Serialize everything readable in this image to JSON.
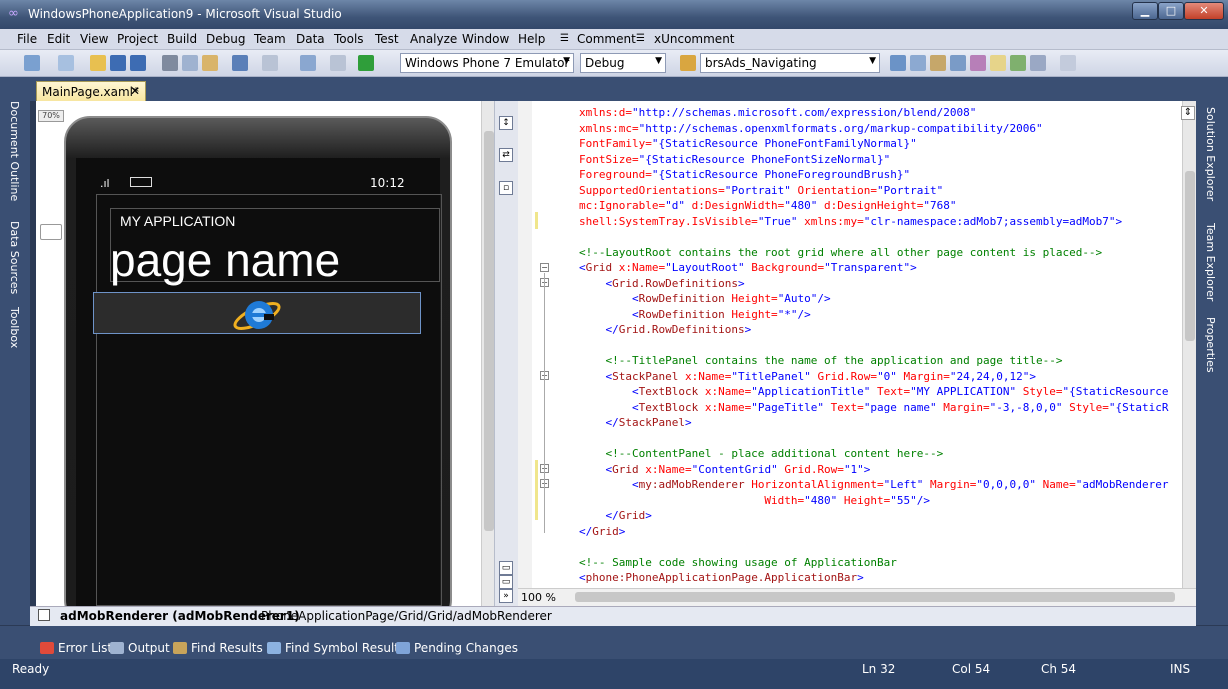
{
  "window": {
    "title": "WindowsPhoneApplication9 - Microsoft Visual Studio",
    "min": "▁",
    "max": "□",
    "close": "✕"
  },
  "menu": [
    "File",
    "Edit",
    "View",
    "Project",
    "Build",
    "Debug",
    "Team",
    "Data",
    "Tools",
    "Test",
    "Analyze",
    "Window",
    "Help",
    "Comment",
    "xUncomment"
  ],
  "toolbar": {
    "target": "Windows Phone 7 Emulator",
    "config": "Debug",
    "find": "brsAds_Navigating"
  },
  "left_rail": [
    "Document Outline",
    "Data Sources",
    "Toolbox"
  ],
  "right_rail": [
    "Solution Explorer",
    "Team Explorer",
    "Properties"
  ],
  "doc_tab": {
    "label": "MainPage.xaml*",
    "close": "✕"
  },
  "designer": {
    "zoom": "70%",
    "signal": ".ıl",
    "time": "10:12",
    "app_title": "MY APPLICATION",
    "page_title": "page name"
  },
  "code_lines": [
    [
      [
        "attr",
        "xmlns:d="
      ],
      [
        "val",
        "\"http://schemas.microsoft.com/expression/blend/2008\""
      ]
    ],
    [
      [
        "attr",
        "xmlns:mc="
      ],
      [
        "val",
        "\"http://schemas.openxmlformats.org/markup-compatibility/2006\""
      ]
    ],
    [
      [
        "attr",
        "FontFamily="
      ],
      [
        "val",
        "\"{StaticResource PhoneFontFamilyNormal}\""
      ]
    ],
    [
      [
        "attr",
        "FontSize="
      ],
      [
        "val",
        "\"{StaticResource PhoneFontSizeNormal}\""
      ]
    ],
    [
      [
        "attr",
        "Foreground="
      ],
      [
        "val",
        "\"{StaticResource PhoneForegroundBrush}\""
      ]
    ],
    [
      [
        "attr",
        "SupportedOrientations="
      ],
      [
        "val",
        "\"Portrait\""
      ],
      [
        "attr",
        " Orientation="
      ],
      [
        "val",
        "\"Portrait\""
      ]
    ],
    [
      [
        "attr",
        "mc:Ignorable="
      ],
      [
        "val",
        "\"d\""
      ],
      [
        "attr",
        " d:DesignWidth="
      ],
      [
        "val",
        "\"480\""
      ],
      [
        "attr",
        " d:DesignHeight="
      ],
      [
        "val",
        "\"768\""
      ]
    ],
    [
      [
        "attr",
        "shell:SystemTray.IsVisible="
      ],
      [
        "val",
        "\"True\""
      ],
      [
        "attr",
        " xmlns:my="
      ],
      [
        "val",
        "\"clr-namespace:adMob7;assembly=adMob7\""
      ],
      [
        "val",
        ">"
      ]
    ],
    [],
    [
      [
        "comment",
        "<!--LayoutRoot contains the root grid where all other page content is placed-->"
      ]
    ],
    [
      [
        "val",
        "<"
      ],
      [
        "tag",
        "Grid"
      ],
      [
        "attr",
        " x:Name="
      ],
      [
        "val",
        "\"LayoutRoot\""
      ],
      [
        "attr",
        " Background="
      ],
      [
        "val",
        "\"Transparent\">"
      ]
    ],
    [
      [
        "val",
        "    <"
      ],
      [
        "tag",
        "Grid.RowDefinitions"
      ],
      [
        "val",
        ">"
      ]
    ],
    [
      [
        "val",
        "        <"
      ],
      [
        "tag",
        "RowDefinition"
      ],
      [
        "attr",
        " Height="
      ],
      [
        "val",
        "\"Auto\"/>"
      ]
    ],
    [
      [
        "val",
        "        <"
      ],
      [
        "tag",
        "RowDefinition"
      ],
      [
        "attr",
        " Height="
      ],
      [
        "val",
        "\"*\"/>"
      ]
    ],
    [
      [
        "val",
        "    </"
      ],
      [
        "tag",
        "Grid.RowDefinitions"
      ],
      [
        "val",
        ">"
      ]
    ],
    [],
    [
      [
        "comment",
        "    <!--TitlePanel contains the name of the application and page title-->"
      ]
    ],
    [
      [
        "val",
        "    <"
      ],
      [
        "tag",
        "StackPanel"
      ],
      [
        "attr",
        " x:Name="
      ],
      [
        "val",
        "\"TitlePanel\""
      ],
      [
        "attr",
        " Grid.Row="
      ],
      [
        "val",
        "\"0\""
      ],
      [
        "attr",
        " Margin="
      ],
      [
        "val",
        "\"24,24,0,12\">"
      ]
    ],
    [
      [
        "val",
        "        <"
      ],
      [
        "tag",
        "TextBlock"
      ],
      [
        "attr",
        " x:Name="
      ],
      [
        "val",
        "\"ApplicationTitle\""
      ],
      [
        "attr",
        " Text="
      ],
      [
        "val",
        "\"MY APPLICATION\""
      ],
      [
        "attr",
        " Style="
      ],
      [
        "val",
        "\"{StaticResource"
      ]
    ],
    [
      [
        "val",
        "        <"
      ],
      [
        "tag",
        "TextBlock"
      ],
      [
        "attr",
        " x:Name="
      ],
      [
        "val",
        "\"PageTitle\""
      ],
      [
        "attr",
        " Text="
      ],
      [
        "val",
        "\"page name\""
      ],
      [
        "attr",
        " Margin="
      ],
      [
        "val",
        "\"-3,-8,0,0\""
      ],
      [
        "attr",
        " Style="
      ],
      [
        "val",
        "\"{StaticR"
      ]
    ],
    [
      [
        "val",
        "    </"
      ],
      [
        "tag",
        "StackPanel"
      ],
      [
        "val",
        ">"
      ]
    ],
    [],
    [
      [
        "comment",
        "    <!--ContentPanel - place additional content here-->"
      ]
    ],
    [
      [
        "val",
        "    <"
      ],
      [
        "tag",
        "Grid"
      ],
      [
        "attr",
        " x:Name="
      ],
      [
        "val",
        "\"ContentGrid\""
      ],
      [
        "attr",
        " Grid.Row="
      ],
      [
        "val",
        "\"1\">"
      ]
    ],
    [
      [
        "val",
        "        <"
      ],
      [
        "tag",
        "my:adMobRenderer"
      ],
      [
        "attr",
        " HorizontalAlignment="
      ],
      [
        "val",
        "\"Left\""
      ],
      [
        "attr",
        " Margin="
      ],
      [
        "val",
        "\"0,0,0,0\""
      ],
      [
        "attr",
        " Name="
      ],
      [
        "val",
        "\"adMobRenderer"
      ]
    ],
    [
      [
        "attr",
        "                            Width="
      ],
      [
        "val",
        "\"480\""
      ],
      [
        "attr",
        " Height="
      ],
      [
        "val",
        "\"55\"/>"
      ]
    ],
    [
      [
        "val",
        "    </"
      ],
      [
        "tag",
        "Grid"
      ],
      [
        "val",
        ">"
      ]
    ],
    [
      [
        "val",
        "</"
      ],
      [
        "tag",
        "Grid"
      ],
      [
        "val",
        ">"
      ]
    ],
    [],
    [
      [
        "comment",
        "<!-- Sample code showing usage of ApplicationBar"
      ]
    ],
    [
      [
        "val",
        "<"
      ],
      [
        "tag",
        "phone:PhoneApplicationPage.ApplicationBar"
      ],
      [
        "val",
        ">"
      ]
    ]
  ],
  "editor_zoom": "100 %",
  "breadcrumb": {
    "element": "adMobRenderer (adMobRenderer1)",
    "path": "PhoneApplicationPage/Grid/Grid/adMobRenderer"
  },
  "tool_windows": [
    "Error List",
    "Output",
    "Find Results 1",
    "Find Symbol Results",
    "Pending Changes"
  ],
  "status": {
    "ready": "Ready",
    "ln": "Ln 32",
    "col": "Col 54",
    "ch": "Ch 54",
    "ins": "INS"
  }
}
